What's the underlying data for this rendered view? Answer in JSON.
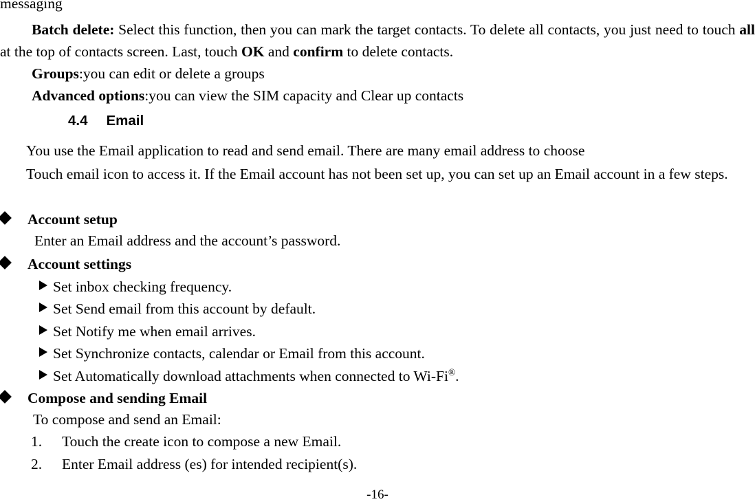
{
  "document": {
    "page_number_label": "-16-",
    "body_text_color": "#000000",
    "background_color": "#ffffff"
  },
  "continued_line": {
    "text": "messaging"
  },
  "batch_delete_paragraph": {
    "label": "Batch delete:",
    "text_1": " Select this function, then you can mark the target contacts. To delete all contacts, you just need to touch ",
    "bold_all": "all",
    "text_2": " at the top of contacts screen. Last, touch ",
    "bold_ok": "OK",
    "text_3": " and ",
    "bold_confirm": "confirm",
    "text_4": " to delete contacts."
  },
  "groups_line": {
    "label": "Groups",
    "text": ":you can edit or delete a groups"
  },
  "advanced_options_line": {
    "label": "Advanced options",
    "text": ":you can view the SIM capacity and Clear up contacts"
  },
  "heading": {
    "number": "4.4",
    "title": "Email"
  },
  "intro": {
    "line_1": "You use the Email application to read and send email. There are many email address to choose",
    "paragraph_2": "Touch email icon to access it. If the Email account has not been set up, you can set up an Email account in a few steps."
  },
  "sections": [
    {
      "bullet": "diamond-bullet-icon",
      "label": "Account setup",
      "body": "Enter an Email address and the account’s password.",
      "sub_items": []
    },
    {
      "bullet": "diamond-bullet-icon",
      "label": "Account settings",
      "body": "",
      "sub_items": [
        "Set inbox checking frequency.",
        "Set Send email from this account by default.",
        "Set Notify me when email arrives.",
        "Set Synchronize contacts, calendar or Email from this account.",
        "Set Automatically download attachments when connected to Wi-Fi"
      ],
      "sub_item_5_suffix": ".",
      "sub_item_5_superscript": "®"
    },
    {
      "bullet": "diamond-bullet-icon",
      "label": "Compose and sending Email",
      "body": "To compose and send an Email:",
      "sub_items": []
    }
  ],
  "numbered_steps": [
    {
      "marker": "1.",
      "text": "Touch the create icon to compose a new Email."
    },
    {
      "marker": "2.",
      "text": "Enter Email address (es) for intended recipient(s)."
    }
  ]
}
